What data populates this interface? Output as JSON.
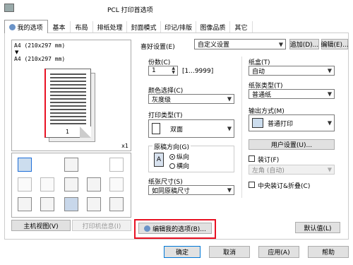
{
  "window": {
    "title": "PCL 打印首选项"
  },
  "tabs": [
    {
      "label": "我的选项"
    },
    {
      "label": "基本"
    },
    {
      "label": "布局"
    },
    {
      "label": "排纸处理"
    },
    {
      "label": "封面模式"
    },
    {
      "label": "印记/排版"
    },
    {
      "label": "图像品质"
    },
    {
      "label": "其它"
    }
  ],
  "preview": {
    "paper_line1": "A4 (210x297 mm)",
    "paper_line2": "A4 (210x297 mm)",
    "page_number": "1",
    "scale": "x1"
  },
  "left_buttons": {
    "printer_view": "主机视图(V)",
    "printer_info": "打印机信息(I)"
  },
  "favorites": {
    "label": "喜好设置(E)",
    "value": "自定义设置",
    "add": "追加(D)...",
    "edit": "编辑(E)..."
  },
  "copies": {
    "label": "份数(C)",
    "value": "1",
    "range": "[1...9999]"
  },
  "color": {
    "label": "颜色选择(C)",
    "value": "灰度级"
  },
  "print_type": {
    "label": "打印类型(T)",
    "value": "双面"
  },
  "orientation": {
    "label": "原稿方向(G)",
    "portrait": "纵向",
    "landscape": "横向"
  },
  "paper_size": {
    "label": "纸张尺寸(S)",
    "value": "如同原稿尺寸"
  },
  "tray": {
    "label": "纸盒(T)",
    "value": "自动"
  },
  "paper_type": {
    "label": "纸张类型(T)",
    "value": "普通纸"
  },
  "output": {
    "label": "输出方式(M)",
    "value": "普通打印",
    "user_settings": "用户设置(U)..."
  },
  "binding": {
    "label": "装订(F)",
    "position": "左角 (自动)"
  },
  "center_staple": {
    "label": "中央装订&折叠(C)"
  },
  "edit_options": {
    "label": "编辑我的选项(B)..."
  },
  "defaults": {
    "label": "默认值(L)"
  },
  "footer": {
    "ok": "确定",
    "cancel": "取消",
    "apply": "应用(A)",
    "help": "帮助"
  },
  "colors": {
    "highlight": "#e81123",
    "selected_blue": "#1e6ed8"
  }
}
